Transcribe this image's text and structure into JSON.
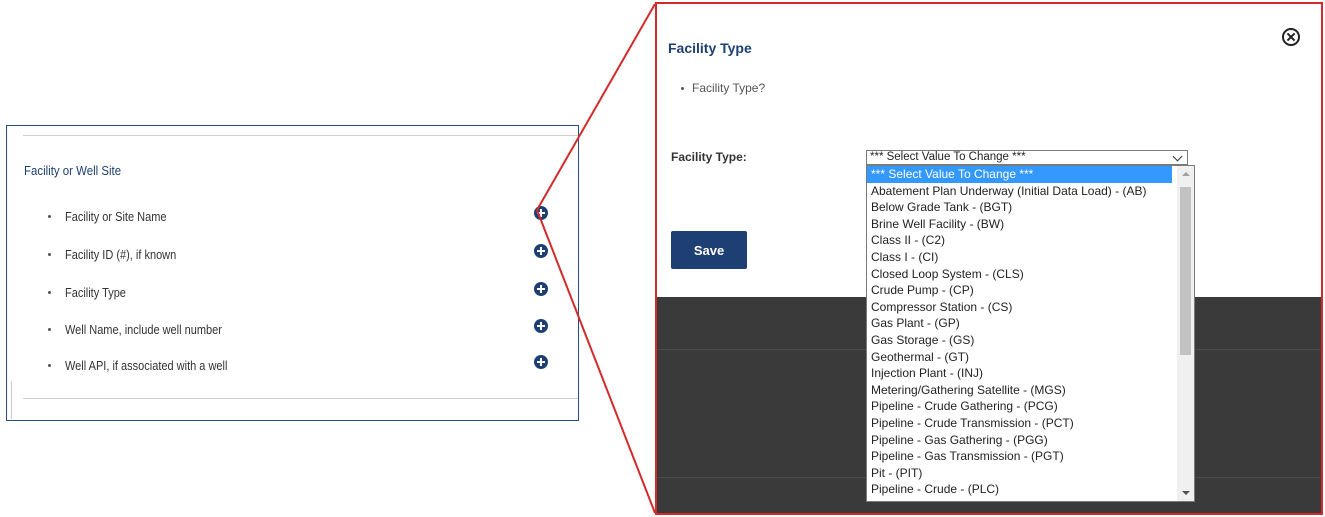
{
  "left_panel": {
    "section_title": "Facility or Well Site",
    "fields": [
      {
        "label": "Facility or Site Name",
        "action_icon": "plus-circle-icon"
      },
      {
        "label": "Facility ID (#), if known",
        "action_icon": "plus-circle-icon"
      },
      {
        "label": "Facility Type",
        "action_icon": "plus-circle-icon"
      },
      {
        "label": "Well Name, include well number",
        "action_icon": "plus-circle-icon"
      },
      {
        "label": "Well API, if associated with a well",
        "action_icon": "plus-circle-icon"
      }
    ]
  },
  "modal": {
    "title": "Facility Type",
    "bullet": "Facility Type?",
    "field_label": "Facility Type:",
    "select_value": "*** Select Value To Change ***",
    "save_label": "Save",
    "close_icon": "close-circle-icon",
    "options": [
      "*** Select Value To Change ***",
      "Abatement Plan Underway (Initial Data Load) - (AB)",
      "Below Grade Tank - (BGT)",
      "Brine Well Facility - (BW)",
      "Class II - (C2)",
      "Class I - (CI)",
      "Closed Loop System - (CLS)",
      "Crude Pump - (CP)",
      "Compressor Station - (CS)",
      "Gas Plant - (GP)",
      "Gas Storage - (GS)",
      "Geothermal - (GT)",
      "Injection Plant - (INJ)",
      "Metering/Gathering Satellite - (MGS)",
      "Pipeline - Crude Gathering - (PCG)",
      "Pipeline - Crude Transmission - (PCT)",
      "Pipeline - Gas Gathering - (PGG)",
      "Pipeline - Gas Transmission - (PGT)",
      "Pit - (PIT)",
      "Pipeline - Crude - (PLC)"
    ],
    "selected_option_index": 0
  },
  "colors": {
    "brand_blue": "#1d3f73",
    "callout_red": "#d42a2a",
    "selected_option": "#3399ff",
    "overlay_dark": "#3a3a3a"
  }
}
